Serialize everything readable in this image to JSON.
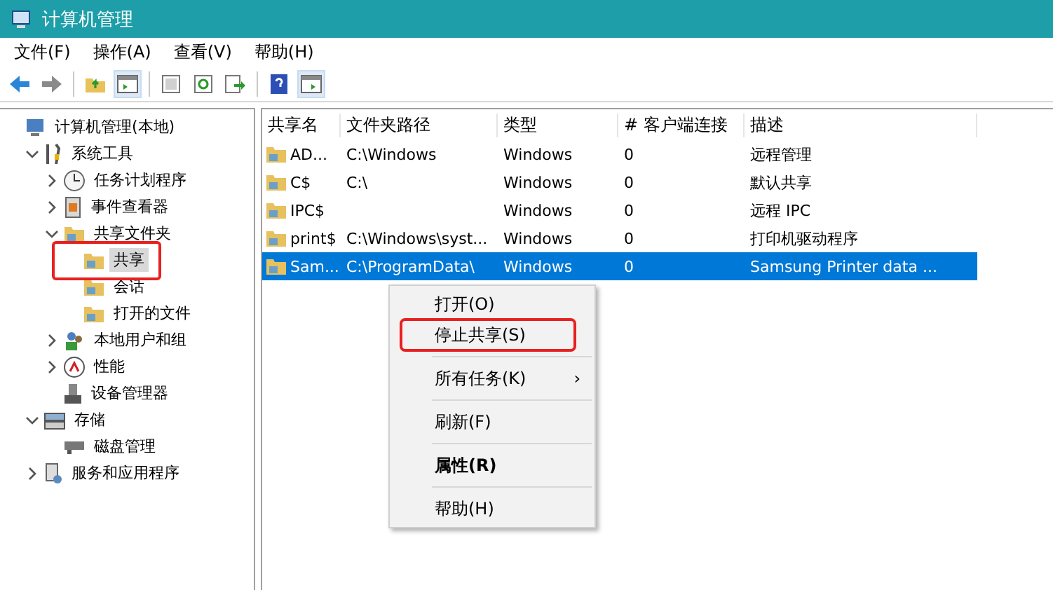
{
  "window": {
    "title": "计算机管理"
  },
  "menu": [
    "文件(F)",
    "操作(A)",
    "查看(V)",
    "帮助(H)"
  ],
  "toolbar": [
    {
      "kind": "back",
      "pressed": false
    },
    {
      "kind": "forward",
      "pressed": false
    },
    {
      "kind": "sep"
    },
    {
      "kind": "up",
      "pressed": false
    },
    {
      "kind": "tree",
      "pressed": true
    },
    {
      "kind": "sep"
    },
    {
      "kind": "props",
      "pressed": false
    },
    {
      "kind": "refresh",
      "pressed": false
    },
    {
      "kind": "export",
      "pressed": false
    },
    {
      "kind": "sep"
    },
    {
      "kind": "help",
      "pressed": false
    },
    {
      "kind": "pane",
      "pressed": true
    }
  ],
  "tree": [
    {
      "label": "计算机管理(本地)",
      "kind": "computer",
      "children": [
        {
          "label": "系统工具",
          "kind": "tool",
          "expanded": true,
          "children": [
            {
              "label": "任务计划程序",
              "kind": "clock",
              "expanded": false
            },
            {
              "label": "事件查看器",
              "kind": "log",
              "expanded": false
            },
            {
              "label": "共享文件夹",
              "kind": "folder",
              "expanded": true,
              "children": [
                {
                  "label": "共享",
                  "kind": "folder",
                  "selected": true
                },
                {
                  "label": "会话",
                  "kind": "folder",
                  "selected": false
                },
                {
                  "label": "打开的文件",
                  "kind": "folder",
                  "selected": false
                }
              ]
            },
            {
              "label": "本地用户和组",
              "kind": "users",
              "expanded": false
            },
            {
              "label": "性能",
              "kind": "perf",
              "expanded": false
            },
            {
              "label": "设备管理器",
              "kind": "device"
            }
          ]
        },
        {
          "label": "存储",
          "kind": "storage",
          "expanded": true,
          "children": [
            {
              "label": "磁盘管理",
              "kind": "disk"
            }
          ]
        },
        {
          "label": "服务和应用程序",
          "kind": "services",
          "expanded": false
        }
      ]
    }
  ],
  "table": {
    "columns": [
      "共享名",
      "文件夹路径",
      "类型",
      "# 客户端连接",
      "描述"
    ],
    "rows": [
      {
        "cells": [
          "AD...",
          "C:\\Windows",
          "Windows",
          "0",
          "远程管理"
        ],
        "selected": false
      },
      {
        "cells": [
          "C$",
          "C:\\",
          "Windows",
          "0",
          "默认共享"
        ],
        "selected": false
      },
      {
        "cells": [
          "IPC$",
          "",
          "Windows",
          "0",
          "远程 IPC"
        ],
        "selected": false
      },
      {
        "cells": [
          "print$",
          "C:\\Windows\\syst...",
          "Windows",
          "0",
          "打印机驱动程序"
        ],
        "selected": false
      },
      {
        "cells": [
          "Sam...",
          "C:\\ProgramData\\",
          "Windows",
          "0",
          "Samsung Printer data ..."
        ],
        "selected": true
      }
    ]
  },
  "context_menu": [
    {
      "label": "打开(O)",
      "highlighted": false
    },
    {
      "label": "停止共享(S)",
      "highlighted": true
    },
    {
      "kind": "sep"
    },
    {
      "label": "所有任务(K)",
      "submenu": "›",
      "highlighted": false
    },
    {
      "kind": "sep"
    },
    {
      "label": "刷新(F)",
      "highlighted": false
    },
    {
      "kind": "sep"
    },
    {
      "label": "属性(R)",
      "bold": true,
      "highlighted": false
    },
    {
      "kind": "sep"
    },
    {
      "label": "帮助(H)",
      "highlighted": false
    }
  ]
}
